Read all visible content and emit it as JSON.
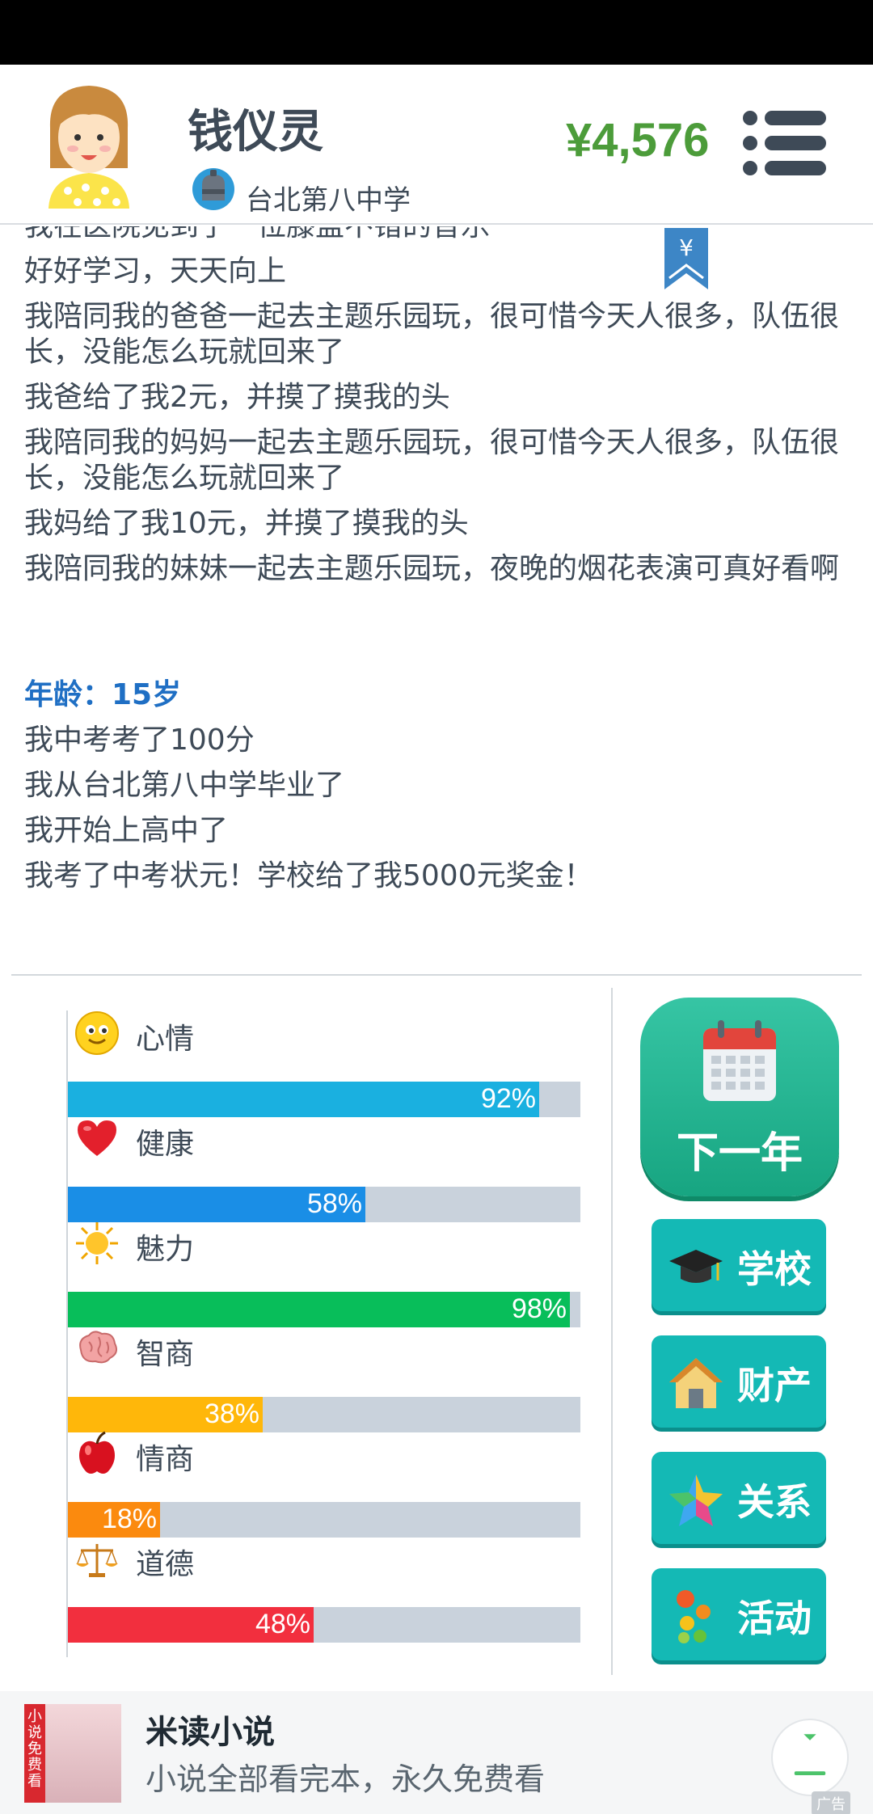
{
  "header": {
    "player_name": "钱仪灵",
    "school": "台北第八中学",
    "money": "¥4,576"
  },
  "log": {
    "partial_line": "我在医院见到了一位膝盖不错的音乐",
    "lines_before": [
      "好好学习，天天向上",
      "我陪同我的爸爸一起去主题乐园玩，很可惜今天人很多，队伍很长，没能怎么玩就回来了",
      "我爸给了我2元，并摸了摸我的头",
      "我陪同我的妈妈一起去主题乐园玩，很可惜今天人很多，队伍很长，没能怎么玩就回来了",
      "我妈给了我10元，并摸了摸我的头",
      "我陪同我的妹妹一起去主题乐园玩，夜晚的烟花表演可真好看啊"
    ],
    "age_heading": "年龄：15岁",
    "lines_after": [
      "我中考考了100分",
      "我从台北第八中学毕业了",
      "我开始上高中了",
      "我考了中考状元！学校给了我5000元奖金！"
    ],
    "bookmark_symbol": "¥"
  },
  "stats": [
    {
      "label": "心情",
      "value": 92,
      "text": "92%",
      "color": "#1ab0e0",
      "icon": "smiley-icon"
    },
    {
      "label": "健康",
      "value": 58,
      "text": "58%",
      "color": "#1a8ee6",
      "icon": "heart-icon"
    },
    {
      "label": "魅力",
      "value": 98,
      "text": "98%",
      "color": "#08be5a",
      "icon": "sun-icon"
    },
    {
      "label": "智商",
      "value": 38,
      "text": "38%",
      "color": "#ffb70a",
      "icon": "brain-icon"
    },
    {
      "label": "情商",
      "value": 18,
      "text": "18%",
      "color": "#fb8a0e",
      "icon": "apple-icon"
    },
    {
      "label": "道德",
      "value": 48,
      "text": "48%",
      "color": "#f22f3e",
      "icon": "scales-icon"
    }
  ],
  "actions": {
    "next_year": "下一年",
    "school": "学校",
    "property": "财产",
    "relations": "关系",
    "activities": "活动"
  },
  "ad": {
    "thumb_tag": "小说免费看",
    "title": "米读小说",
    "description": "小说全部看完本，永久免费看",
    "badge": "广告"
  }
}
